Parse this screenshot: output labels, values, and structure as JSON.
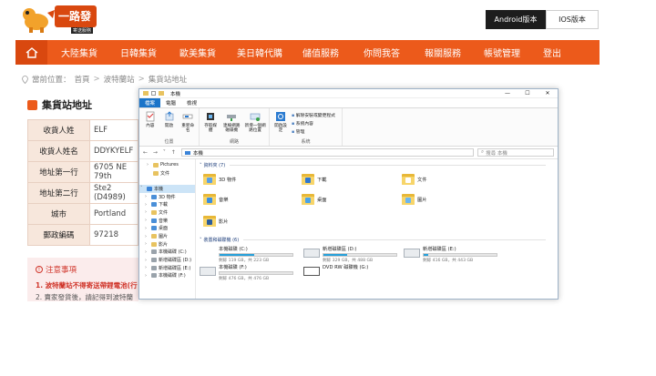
{
  "site": {
    "logo_text": "一路發",
    "logo_sub": "寄送服務",
    "app_buttons": [
      "Android版本",
      "IOS版本"
    ]
  },
  "nav": {
    "items": [
      "大陸集貨",
      "日韓集貨",
      "歐美集貨",
      "美日韓代購",
      "儲值服務",
      "你問我答",
      "報關服務",
      "帳號管理",
      "登出"
    ]
  },
  "breadcrumb": {
    "current_label": "當前位置：",
    "items": [
      "首頁",
      "波特蘭站",
      "集貨站地址"
    ]
  },
  "panel": {
    "title": "集貨站地址",
    "rows": [
      {
        "label": "收貨人姓",
        "value": "ELF"
      },
      {
        "label": "收貨人姓名",
        "value": "DDYKYELF"
      },
      {
        "label": "地址第一行",
        "value": "6705 NE 79th"
      },
      {
        "label": "地址第二行",
        "value": "Ste2 (D4989)"
      },
      {
        "label": "城市",
        "value": "Portland"
      },
      {
        "label": "郵政編碼",
        "value": "97218"
      }
    ],
    "notice_title": "注意事項",
    "notice_lines": [
      "1. 波特蘭站不得寄送帶鋰電池(行",
      "2. 賣家發貨後，請記得到波特蘭"
    ]
  },
  "explorer": {
    "title": "本機",
    "window_controls": [
      "—",
      "☐",
      "✕"
    ],
    "tabs": [
      "檔案",
      "電腦",
      "檢視"
    ],
    "ribbon": {
      "location": {
        "name": "位置",
        "buttons": [
          "內容",
          "開啟",
          "重新命名"
        ]
      },
      "network": {
        "name": "網路",
        "buttons": [
          "存取媒體",
          "連線網路磁碟機",
          "新增一個網路位置"
        ]
      },
      "system": {
        "name": "系統",
        "buttons": [
          "開啟設定"
        ],
        "links": [
          "解除安裝或變更程式",
          "系統內容",
          "管理"
        ]
      }
    },
    "address": {
      "arrows": "← → ˅ ↑",
      "path": "本機",
      "search_placeholder": "搜尋 本機"
    },
    "tree": [
      {
        "label": "Pictures",
        "type": "folder",
        "chev": "›"
      },
      {
        "label": "文件",
        "type": "folder",
        "chev": ""
      },
      {
        "label": "",
        "type": "spacer",
        "chev": ""
      },
      {
        "label": "本機",
        "type": "pc",
        "chev": "˅",
        "selected": true
      },
      {
        "label": "3D 物件",
        "type": "blue",
        "chev": "›"
      },
      {
        "label": "下載",
        "type": "blue",
        "chev": "›"
      },
      {
        "label": "文件",
        "type": "folder",
        "chev": "›"
      },
      {
        "label": "音樂",
        "type": "blue",
        "chev": "›"
      },
      {
        "label": "桌面",
        "type": "blue",
        "chev": "›"
      },
      {
        "label": "圖片",
        "type": "folder",
        "chev": "›"
      },
      {
        "label": "影片",
        "type": "folder",
        "chev": "›"
      },
      {
        "label": "本機磁碟 (C:)",
        "type": "drive",
        "chev": "›"
      },
      {
        "label": "新增磁碟區 (D:)",
        "type": "drive",
        "chev": "›"
      },
      {
        "label": "新增磁碟區 (E:)",
        "type": "drive",
        "chev": "›"
      },
      {
        "label": "本機磁碟 (F:)",
        "type": "drive",
        "chev": "›"
      }
    ],
    "folders_header": "資料夾 (7)",
    "folders": [
      {
        "name": "3D 物件",
        "badge": "#5aa0e6"
      },
      {
        "name": "下載",
        "badge": "#2f78d0"
      },
      {
        "name": "文件",
        "badge": "#ffffff"
      },
      {
        "name": "音樂",
        "badge": "#3a8ee0"
      },
      {
        "name": "桌面",
        "badge": "#4aa3e8"
      },
      {
        "name": "圖片",
        "badge": "#6bb6f0"
      },
      {
        "name": "影片",
        "badge": "#2b5d9c"
      }
    ],
    "drives_header": "裝置和磁碟機 (6)",
    "drives": [
      {
        "name": "本機磁碟 (C:)",
        "free": "剩餘 119 GB，共 223 GB",
        "used": 0.47,
        "kind": "win"
      },
      {
        "name": "新增磁碟區 (D:)",
        "free": "剩餘 329 GB，共 488 GB",
        "used": 0.33,
        "kind": "drive"
      },
      {
        "name": "新增磁碟區 (E:)",
        "free": "剩餘 416 GB，共 443 GB",
        "used": 0.06,
        "kind": "drive"
      },
      {
        "name": "本機磁碟 (F:)",
        "free": "剩餘 476 GB，共 476 GB",
        "used": 0.0,
        "kind": "drive"
      },
      {
        "name": "DVD RW 磁碟機 (G:)",
        "free": "",
        "used": null,
        "kind": "dvd"
      }
    ]
  }
}
